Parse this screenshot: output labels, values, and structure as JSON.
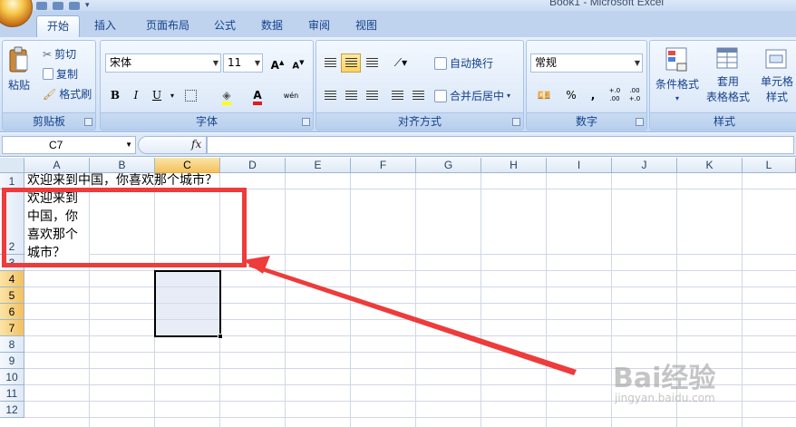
{
  "window": {
    "title": "Book1 - Microsoft Excel"
  },
  "tabs": [
    {
      "label": "开始",
      "active": true
    },
    {
      "label": "插入"
    },
    {
      "label": "页面布局"
    },
    {
      "label": "公式"
    },
    {
      "label": "数据"
    },
    {
      "label": "审阅"
    },
    {
      "label": "视图"
    }
  ],
  "ribbon": {
    "clipboard": {
      "title": "剪贴板",
      "paste": "粘贴",
      "cut": "剪切",
      "copy": "复制",
      "format_painter": "格式刷"
    },
    "font": {
      "title": "字体",
      "font_name": "宋体",
      "font_size": "11",
      "bold": "B",
      "italic": "I",
      "underline": "U",
      "grow": "A",
      "shrink": "A",
      "color_letter": "A",
      "phonetic": "wén"
    },
    "alignment": {
      "title": "对齐方式",
      "wrap_text": "自动换行",
      "merge_center": "合并后居中"
    },
    "number": {
      "title": "数字",
      "format": "常规",
      "percent": "%",
      "comma": ",",
      "inc_decimal": "+.0 .00",
      "dec_decimal": ".00 +.0"
    },
    "styles": {
      "title": "样式",
      "conditional": "条件格式",
      "table_style_1": "套用",
      "table_style_2": "表格格式",
      "cell_style_1": "单元格",
      "cell_style_2": "样式"
    }
  },
  "formula_bar": {
    "name_box": "C7",
    "fx": "fx",
    "value": ""
  },
  "grid": {
    "columns": [
      "A",
      "B",
      "C",
      "D",
      "E",
      "F",
      "G",
      "H",
      "I",
      "J",
      "K",
      "L"
    ],
    "selected_column": "C",
    "rows": [
      "1",
      "2",
      "3",
      "4",
      "5",
      "6",
      "7",
      "8",
      "9",
      "10",
      "11",
      "12"
    ],
    "selected_rows": [
      "4",
      "5",
      "6",
      "7"
    ],
    "a1_text": "欢迎来到中国，你喜欢那个城市？",
    "a2_lines": [
      "欢迎来到",
      "中国，你",
      "喜欢那个",
      "城市？"
    ]
  },
  "colors": {
    "annotation": "#ee3b3b",
    "selection_header": "#f3c15f"
  },
  "watermark": {
    "brand": "Bai经验",
    "url": "jingyan.baidu.com"
  }
}
